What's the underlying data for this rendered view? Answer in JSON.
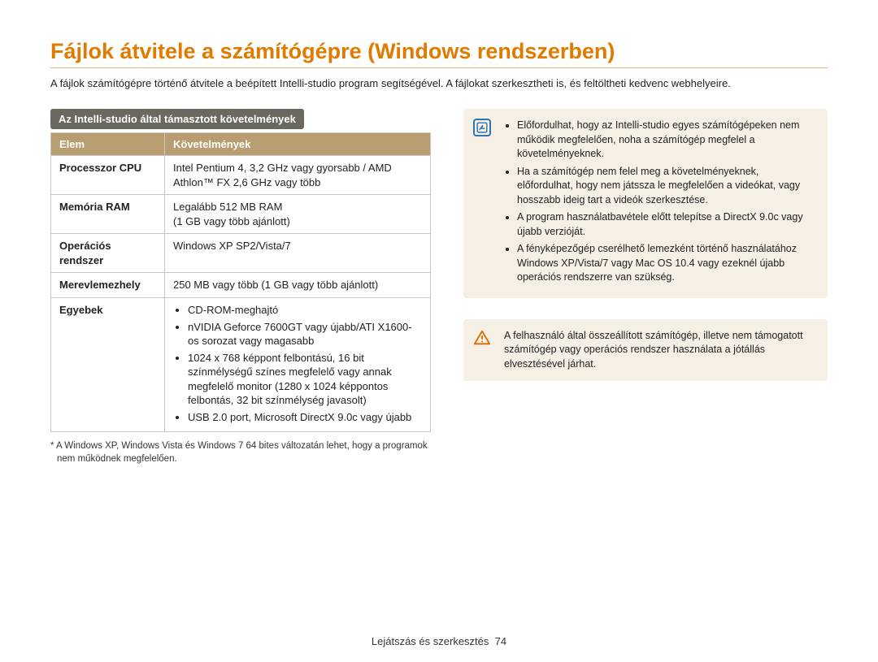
{
  "title": "Fájlok átvitele a számítógépre (Windows rendszerben)",
  "intro": "A fájlok számítógépre történő átvitele a beépített Intelli-studio program segítségével. A fájlokat szerkesztheti is, és feltöltheti kedvenc webhelyeire.",
  "section_heading": "Az Intelli-studio által támasztott követelmények",
  "table": {
    "head_item": "Elem",
    "head_req": "Követelmények",
    "rows": {
      "cpu_label": "Processzor CPU",
      "cpu_value": "Intel Pentium 4, 3,2 GHz vagy gyorsabb / AMD Athlon™ FX 2,6 GHz vagy több",
      "ram_label": "Memória RAM",
      "ram_value": "Legalább 512 MB RAM\n(1 GB vagy több ajánlott)",
      "os_label": "Operációs rendszer",
      "os_value": "Windows XP SP2/Vista/7",
      "hdd_label": "Merevlemezhely",
      "hdd_value": "250 MB vagy több (1 GB vagy több ajánlott)",
      "other_label": "Egyebek",
      "other_items": [
        "CD-ROM-meghajtó",
        "nVIDIA Geforce 7600GT vagy újabb/ATI X1600-os sorozat vagy magasabb",
        "1024 x 768 képpont felbontású, 16 bit színmélységű színes megfelelő vagy annak megfelelő monitor (1280 x 1024 képpontos felbontás, 32 bit színmélység javasolt)",
        "USB 2.0 port, Microsoft DirectX 9.0c vagy újabb"
      ]
    }
  },
  "footnote": "* A Windows XP, Windows Vista és Windows 7 64 bites változatán lehet, hogy a programok nem működnek megfelelően.",
  "info_notes": [
    "Előfordulhat, hogy az Intelli-studio egyes számítógépeken nem működik megfelelően, noha a számítógép megfelel a követelményeknek.",
    "Ha a számítógép nem felel meg a követelményeknek, előfordulhat, hogy nem játssza le megfelelően a videókat, vagy hosszabb ideig tart a videók szerkesztése.",
    "A program használatbavétele előtt telepítse a DirectX 9.0c vagy újabb verzióját.",
    "A fényképezőgép cserélhető lemezként történő használatához Windows XP/Vista/7 vagy Mac OS 10.4 vagy ezeknél újabb operációs rendszerre van szükség."
  ],
  "warn_note": "A felhasználó által összeállított számítógép, illetve nem támogatott számítógép vagy operációs rendszer használata a jótállás elvesztésével járhat.",
  "footer_section": "Lejátszás és szerkesztés",
  "footer_page": "74"
}
